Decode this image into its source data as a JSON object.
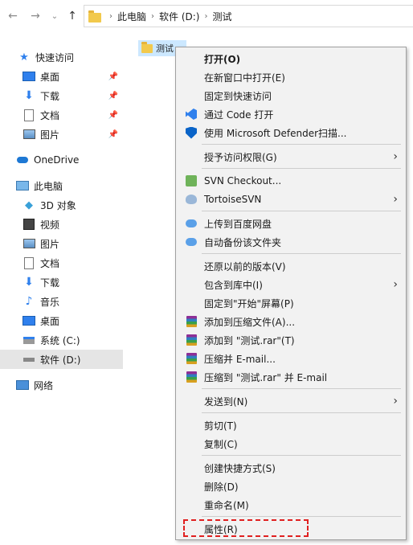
{
  "nav": {
    "back_icon": "arrow-left-icon",
    "forward_icon": "arrow-right-icon",
    "recent_icon": "chevron-down-icon",
    "up_icon": "arrow-up-icon",
    "breadcrumb": [
      "此电脑",
      "软件 (D:)",
      "测试"
    ]
  },
  "sidebar": {
    "quick_access": "快速访问",
    "quick_items": [
      "桌面",
      "下载",
      "文档",
      "图片"
    ],
    "onedrive": "OneDrive",
    "this_pc": "此电脑",
    "pc_items": [
      "3D 对象",
      "视频",
      "图片",
      "文档",
      "下载",
      "音乐",
      "桌面",
      "系统 (C:)",
      "软件 (D:)"
    ],
    "network": "网络"
  },
  "file": {
    "name": "测试"
  },
  "menu": {
    "open": "打开(O)",
    "open_new_window": "在新窗口中打开(E)",
    "pin_quick_access": "固定到快速访问",
    "open_with_code": "通过 Code 打开",
    "defender": "使用 Microsoft Defender扫描...",
    "grant_access": "授予访问权限(G)",
    "svn_checkout": "SVN Checkout...",
    "tortoise_svn": "TortoiseSVN",
    "upload_baidu": "上传到百度网盘",
    "auto_backup": "自动备份该文件夹",
    "restore_versions": "还原以前的版本(V)",
    "include_library": "包含到库中(I)",
    "pin_start": "固定到\"开始\"屏幕(P)",
    "add_archive": "添加到压缩文件(A)...",
    "add_rar": "添加到 \"测试.rar\"(T)",
    "compress_email": "压缩并 E-mail...",
    "compress_rar_email": "压缩到 \"测试.rar\" 并 E-mail",
    "send_to": "发送到(N)",
    "cut": "剪切(T)",
    "copy": "复制(C)",
    "create_shortcut": "创建快捷方式(S)",
    "delete": "删除(D)",
    "rename": "重命名(M)",
    "properties": "属性(R)"
  },
  "colors": {
    "selection": "#cce8ff",
    "highlight_box": "#e02020",
    "menu_bg": "#f2f2f2"
  }
}
